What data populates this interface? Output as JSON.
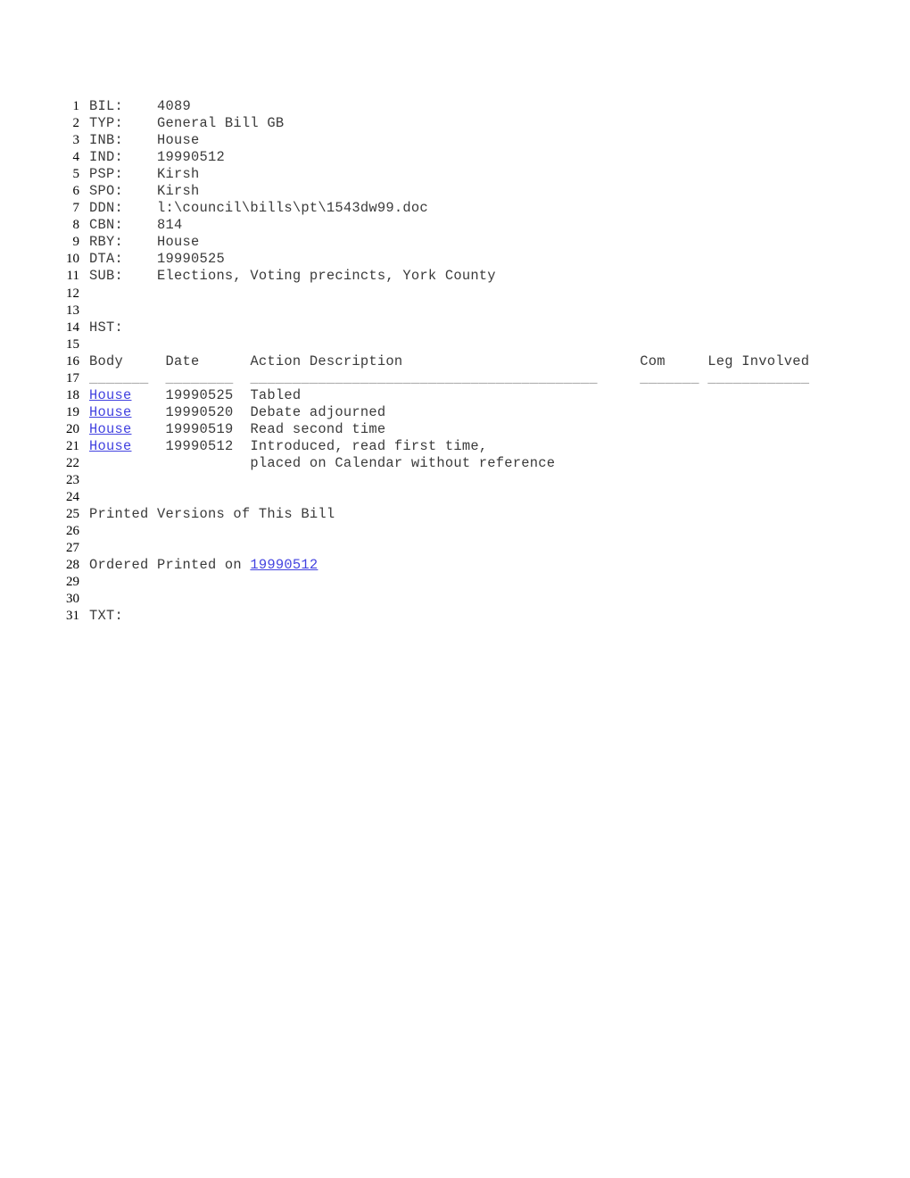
{
  "document": {
    "type": "legislative-bill-record",
    "bill_number": "4089",
    "line_count": 31
  },
  "fields": [
    {
      "label": "BIL:",
      "value": "4089"
    },
    {
      "label": "TYP:",
      "value": "General Bill GB"
    },
    {
      "label": "INB:",
      "value": "House"
    },
    {
      "label": "IND:",
      "value": "19990512"
    },
    {
      "label": "PSP:",
      "value": "Kirsh"
    },
    {
      "label": "SPO:",
      "value": "Kirsh"
    },
    {
      "label": "DDN:",
      "value": "l:\\council\\bills\\pt\\1543dw99.doc"
    },
    {
      "label": "CBN:",
      "value": "814"
    },
    {
      "label": "RBY:",
      "value": "House"
    },
    {
      "label": "DTA:",
      "value": "19990525"
    },
    {
      "label": "SUB:",
      "value": "Elections, Voting precincts, York County"
    }
  ],
  "history": {
    "section_label": "HST:",
    "columns": {
      "body": "Body",
      "date": "Date",
      "action": "Action Description",
      "com": "Com",
      "leg": "Leg Involved"
    },
    "rules": {
      "body": "_______",
      "date": "________",
      "action": "_________________________________________",
      "com": "_______",
      "leg": "____________"
    },
    "rows": [
      {
        "body": "House",
        "date": "19990525",
        "action": "Tabled"
      },
      {
        "body": "House",
        "date": "19990520",
        "action": "Debate adjourned"
      },
      {
        "body": "House",
        "date": "19990519",
        "action": "Read second time"
      },
      {
        "body": "House",
        "date": "19990512",
        "action": "Introduced, read first time,"
      },
      {
        "body": "",
        "date": "",
        "action": "placed on Calendar without reference"
      }
    ]
  },
  "printed_versions": {
    "heading": "Printed Versions of This Bill",
    "ordered_prefix": "Ordered Printed on ",
    "ordered_date": "19990512"
  },
  "text_section": {
    "label": "TXT:"
  },
  "line_numbers": {
    "n1": "1",
    "n2": "2",
    "n3": "3",
    "n4": "4",
    "n5": "5",
    "n6": "6",
    "n7": "7",
    "n8": "8",
    "n9": "9",
    "n10": "10",
    "n11": "11",
    "n12": "12",
    "n13": "13",
    "n14": "14",
    "n15": "15",
    "n16": "16",
    "n17": "17",
    "n18": "18",
    "n19": "19",
    "n20": "20",
    "n21": "21",
    "n22": "22",
    "n23": "23",
    "n24": "24",
    "n25": "25",
    "n26": "26",
    "n27": "27",
    "n28": "28",
    "n29": "29",
    "n30": "30",
    "n31": "31"
  },
  "colors": {
    "background": "#ffffff",
    "body_text": "#3a3a3a",
    "line_number": "#000000",
    "link": "#4343e0",
    "rule": "#8a8a8a"
  }
}
